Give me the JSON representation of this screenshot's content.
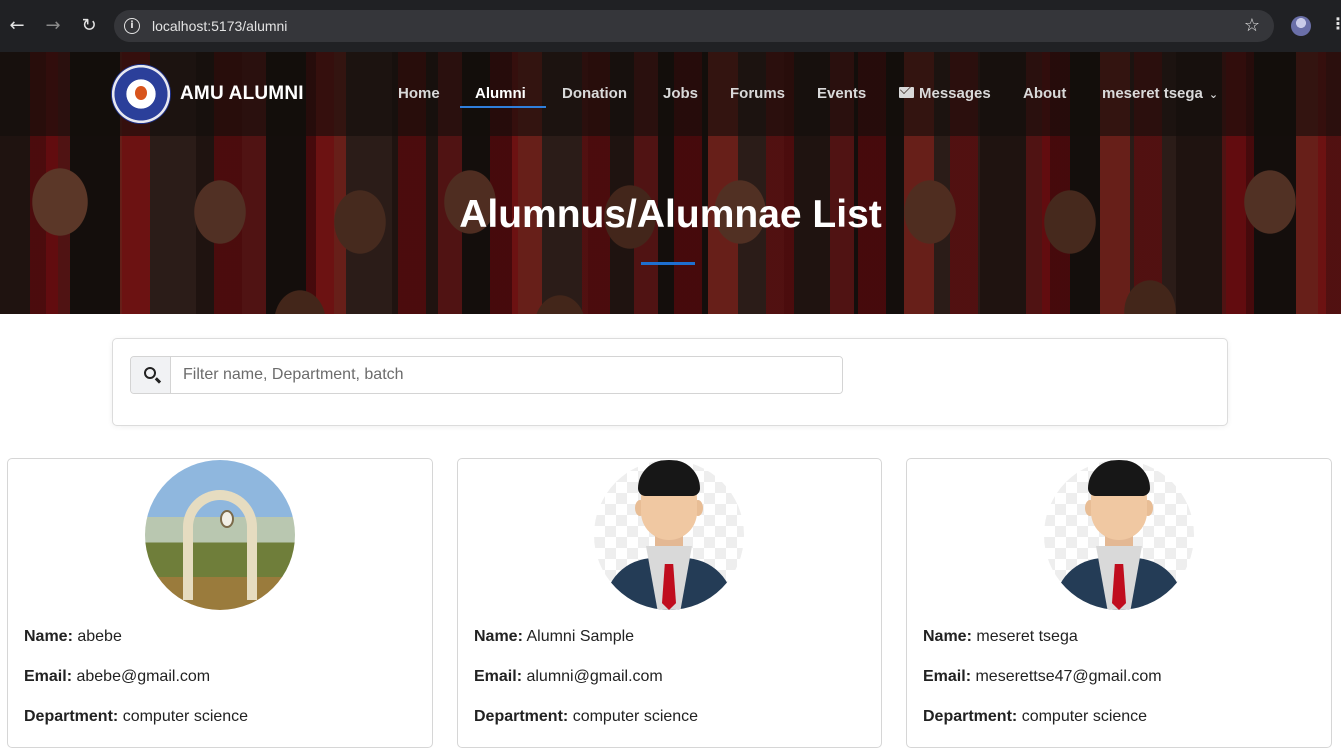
{
  "browser": {
    "back_icon": "arrow-left-icon",
    "forward_icon": "arrow-right-icon",
    "reload_icon": "reload-icon",
    "url": "localhost:5173/alumni"
  },
  "navbar": {
    "brand": "AMU ALUMNI",
    "items": [
      {
        "label": "Home"
      },
      {
        "label": "Alumni",
        "active": true
      },
      {
        "label": "Donation"
      },
      {
        "label": "Jobs"
      },
      {
        "label": "Forums"
      },
      {
        "label": "Events"
      },
      {
        "label": "Messages",
        "icon": "envelope-icon"
      },
      {
        "label": "About"
      }
    ],
    "user_menu": "meseret tsega",
    "accent_color": "#2f7fdc"
  },
  "hero": {
    "title": "Alumnus/Alumnae List"
  },
  "search": {
    "placeholder": "Filter name, Department, batch",
    "value": ""
  },
  "alumni": [
    {
      "avatar": "campus-gate-photo",
      "name_label": "Name:",
      "name": "abebe",
      "email_label": "Email:",
      "email": "abebe@gmail.com",
      "department_label": "Department:",
      "department": "computer science"
    },
    {
      "avatar": "default-male-avatar",
      "name_label": "Name:",
      "name": "Alumni Sample",
      "email_label": "Email:",
      "email": "alumni@gmail.com",
      "department_label": "Department:",
      "department": "computer science"
    },
    {
      "avatar": "default-male-avatar",
      "name_label": "Name:",
      "name": "meseret tsega",
      "email_label": "Email:",
      "email": "meserettse47@gmail.com",
      "department_label": "Department:",
      "department": "computer science"
    }
  ]
}
